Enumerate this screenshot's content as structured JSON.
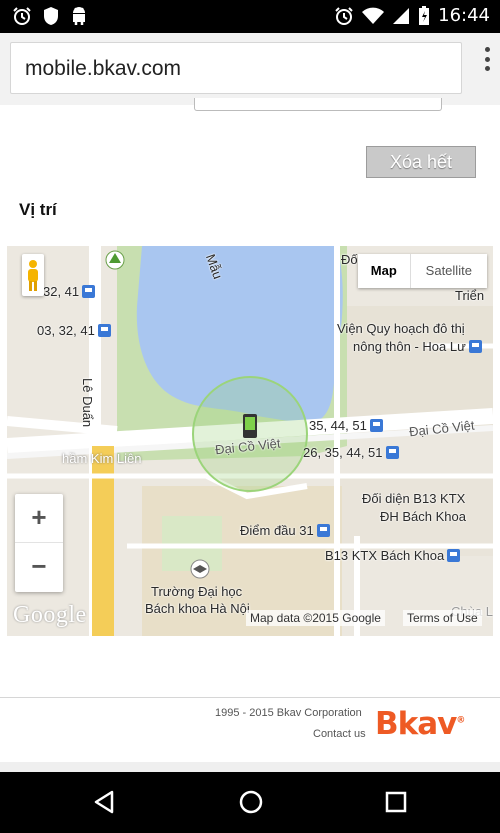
{
  "status_bar": {
    "time": "16:44",
    "icons_left": [
      "alarm-icon",
      "shield-icon",
      "android-icon"
    ],
    "icons_right": [
      "alarm-icon",
      "wifi-icon",
      "signal-icon",
      "battery-charging-icon"
    ]
  },
  "browser": {
    "url": "mobile.bkav.com",
    "menu_icon": "overflow-menu-icon"
  },
  "page": {
    "clear_button": "Xóa hết",
    "section_title": "Vị trí"
  },
  "map": {
    "type_map": "Map",
    "type_satellite": "Satellite",
    "zoom_in": "+",
    "zoom_out": "−",
    "logo": "Google",
    "attribution": "Map data ©2015 Google",
    "terms": "Terms of Use",
    "labels": {
      "lake_name": "Mẫu",
      "bus_32_41": "32, 41",
      "bus_03_32_41": "03, 32, 41",
      "le_duan": "Lê Duẩn",
      "ham_kim_lien": "hầm Kim Liên",
      "dai_co_viet_1": "Đại Cồ Việt",
      "dai_co_viet_2": "Đại Cồ Việt",
      "bus_35_44_51": "35, 44, 51",
      "bus_26_35_44_51": "26, 35, 44, 51",
      "vien_quy_hoach_1": "Viện Quy hoạch đô thị",
      "vien_quy_hoach_2": "nông thôn - Hoa Lư",
      "doi_dien_1": "Đối diện B13 KTX",
      "doi_dien_2": "ĐH Bách Khoa",
      "diem_dau": "Điểm đầu 31",
      "b13": "B13 KTX Bách Khoa",
      "truong_1": "Trường Đại học",
      "truong_2": "Bách khoa Hà Nội",
      "top_right_1": "Đố",
      "top_right_2": "Triển",
      "bottom_right": "Chùa L"
    }
  },
  "footer": {
    "copyright": "1995 - 2015 Bkav Corporation",
    "contact": "Contact us",
    "logo": "Bkav"
  },
  "nav_bar": {
    "back": "back-icon",
    "home": "home-icon",
    "recents": "recents-icon"
  }
}
